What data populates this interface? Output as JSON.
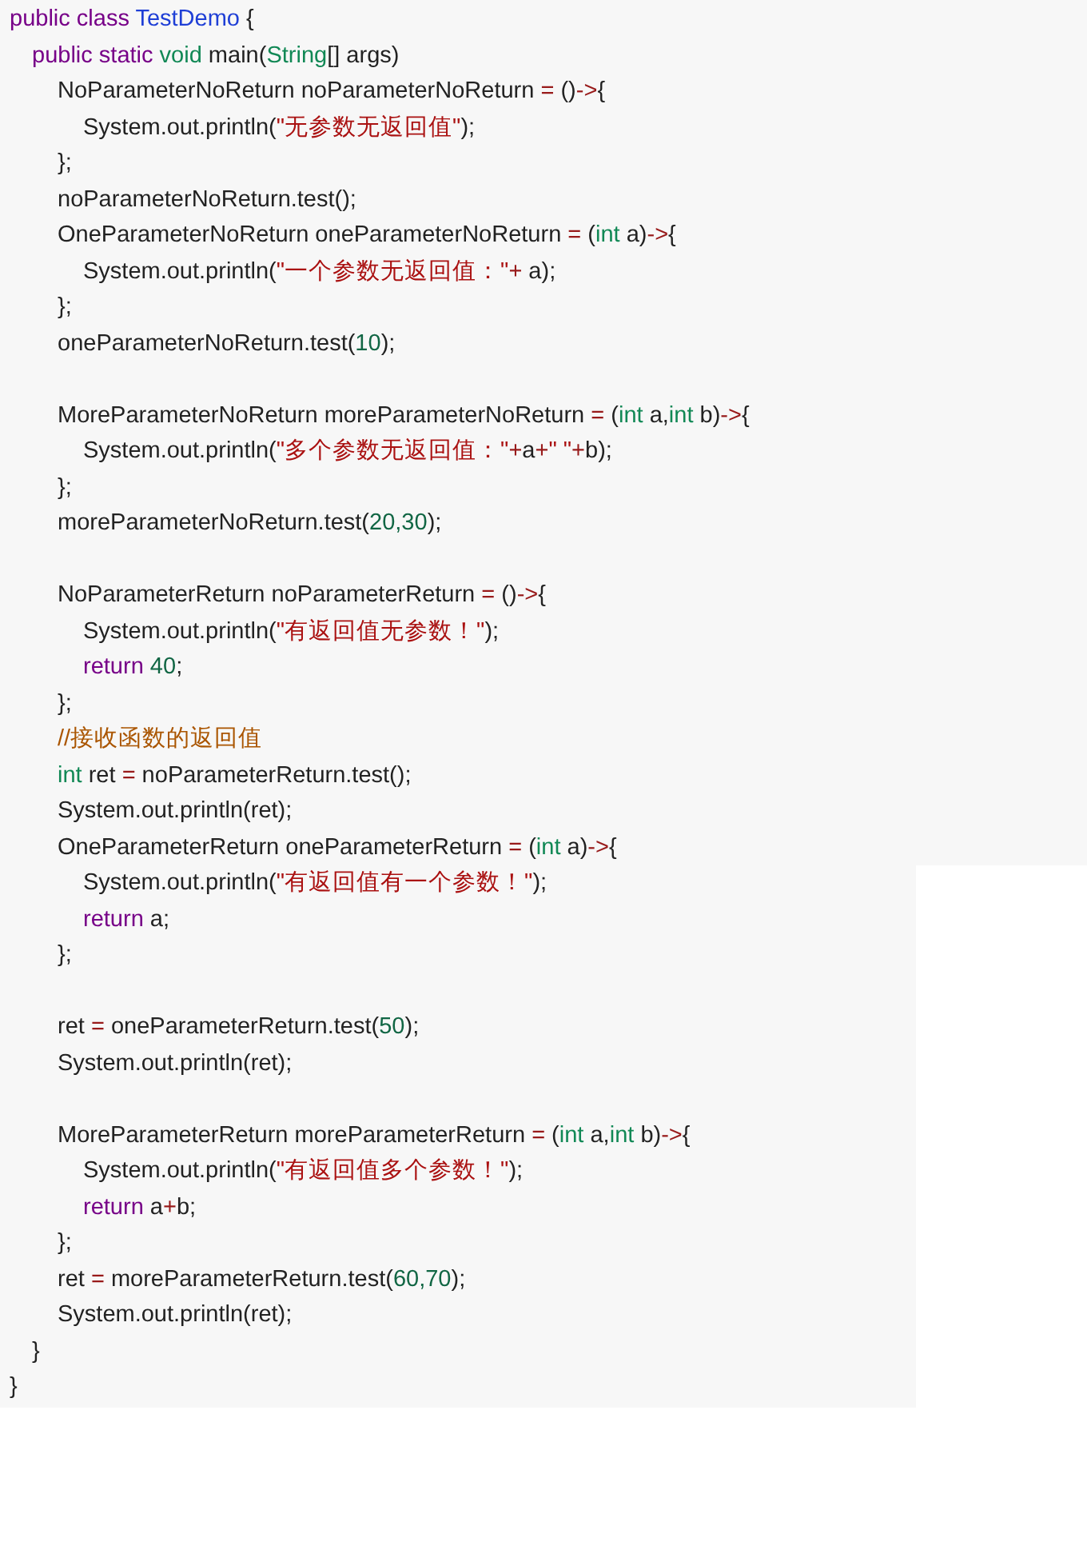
{
  "code_lines": [
    {
      "tokens": [
        {
          "kind": "keyword",
          "text": "public class "
        },
        {
          "kind": "def",
          "text": "TestDemo"
        },
        {
          "kind": "plain",
          "text": " {"
        }
      ],
      "children": [
        {
          "tokens": [
            {
              "kind": "keyword",
              "text": "public static "
            },
            {
              "kind": "type",
              "text": "void"
            },
            {
              "kind": "plain",
              "text": " main("
            },
            {
              "kind": "type",
              "text": "String"
            },
            {
              "kind": "plain",
              "text": "[] args)"
            }
          ],
          "children": [
            {
              "tokens": [
                {
                  "kind": "plain",
                  "text": "NoParameterNoReturn noParameterNoReturn "
                },
                {
                  "kind": "operator",
                  "text": "="
                },
                {
                  "kind": "plain",
                  "text": " ()"
                },
                {
                  "kind": "operator",
                  "text": "->"
                },
                {
                  "kind": "plain",
                  "text": "{"
                }
              ],
              "children": [
                {
                  "tokens": [
                    {
                      "kind": "plain",
                      "text": "System.out.println("
                    },
                    {
                      "kind": "string",
                      "text": "\"无参数无返回值\""
                    },
                    {
                      "kind": "plain",
                      "text": ");"
                    }
                  ]
                }
              ]
            },
            {
              "tokens": [
                {
                  "kind": "plain",
                  "text": "};"
                }
              ]
            },
            {
              "tokens": [
                {
                  "kind": "plain",
                  "text": "noParameterNoReturn.test();"
                }
              ]
            },
            {
              "tokens": [
                {
                  "kind": "plain",
                  "text": "OneParameterNoReturn oneParameterNoReturn "
                },
                {
                  "kind": "operator",
                  "text": "="
                },
                {
                  "kind": "plain",
                  "text": " ("
                },
                {
                  "kind": "type",
                  "text": "int"
                },
                {
                  "kind": "plain",
                  "text": " a)"
                },
                {
                  "kind": "operator",
                  "text": "->"
                },
                {
                  "kind": "plain",
                  "text": "{"
                }
              ],
              "children": [
                {
                  "tokens": [
                    {
                      "kind": "plain",
                      "text": "System.out.println("
                    },
                    {
                      "kind": "string",
                      "text": "\"一个参数无返回值：\""
                    },
                    {
                      "kind": "operator",
                      "text": "+"
                    },
                    {
                      "kind": "plain",
                      "text": " a);"
                    }
                  ]
                }
              ]
            },
            {
              "tokens": [
                {
                  "kind": "plain",
                  "text": "};"
                }
              ]
            },
            {
              "tokens": [
                {
                  "kind": "plain",
                  "text": "oneParameterNoReturn.test("
                },
                {
                  "kind": "number",
                  "text": "10"
                },
                {
                  "kind": "plain",
                  "text": ");"
                }
              ]
            },
            {
              "kind": "blank"
            },
            {
              "tokens": [
                {
                  "kind": "plain",
                  "text": "MoreParameterNoReturn moreParameterNoReturn "
                },
                {
                  "kind": "operator",
                  "text": "="
                },
                {
                  "kind": "plain",
                  "text": " ("
                },
                {
                  "kind": "type",
                  "text": "int"
                },
                {
                  "kind": "plain",
                  "text": " a,"
                },
                {
                  "kind": "type",
                  "text": "int"
                },
                {
                  "kind": "plain",
                  "text": " b)"
                },
                {
                  "kind": "operator",
                  "text": "->"
                },
                {
                  "kind": "plain",
                  "text": "{"
                }
              ],
              "children": [
                {
                  "tokens": [
                    {
                      "kind": "plain",
                      "text": "System.out.println("
                    },
                    {
                      "kind": "string",
                      "text": "\"多个参数无返回值：\""
                    },
                    {
                      "kind": "operator",
                      "text": "+"
                    },
                    {
                      "kind": "plain",
                      "text": "a"
                    },
                    {
                      "kind": "operator",
                      "text": "+"
                    },
                    {
                      "kind": "string",
                      "text": "\" \""
                    },
                    {
                      "kind": "operator",
                      "text": "+"
                    },
                    {
                      "kind": "plain",
                      "text": "b);"
                    }
                  ]
                }
              ]
            },
            {
              "tokens": [
                {
                  "kind": "plain",
                  "text": "};"
                }
              ]
            },
            {
              "tokens": [
                {
                  "kind": "plain",
                  "text": "moreParameterNoReturn.test("
                },
                {
                  "kind": "number",
                  "text": "20,30"
                },
                {
                  "kind": "plain",
                  "text": ");"
                }
              ]
            },
            {
              "kind": "blank"
            },
            {
              "tokens": [
                {
                  "kind": "plain",
                  "text": "NoParameterReturn noParameterReturn "
                },
                {
                  "kind": "operator",
                  "text": "="
                },
                {
                  "kind": "plain",
                  "text": " ()"
                },
                {
                  "kind": "operator",
                  "text": "->"
                },
                {
                  "kind": "plain",
                  "text": "{"
                }
              ],
              "children": [
                {
                  "tokens": [
                    {
                      "kind": "plain",
                      "text": "System.out.println("
                    },
                    {
                      "kind": "string",
                      "text": "\"有返回值无参数！\""
                    },
                    {
                      "kind": "plain",
                      "text": ");"
                    }
                  ]
                },
                {
                  "tokens": [
                    {
                      "kind": "keyword",
                      "text": "return "
                    },
                    {
                      "kind": "number",
                      "text": "40"
                    },
                    {
                      "kind": "plain",
                      "text": ";"
                    }
                  ]
                }
              ]
            },
            {
              "tokens": [
                {
                  "kind": "plain",
                  "text": "};"
                }
              ]
            },
            {
              "tokens": [
                {
                  "kind": "comment",
                  "text": "//接收函数的返回值"
                }
              ]
            },
            {
              "tokens": [
                {
                  "kind": "type",
                  "text": "int"
                },
                {
                  "kind": "plain",
                  "text": " ret "
                },
                {
                  "kind": "operator",
                  "text": "="
                },
                {
                  "kind": "plain",
                  "text": " noParameterReturn.test();"
                }
              ]
            },
            {
              "tokens": [
                {
                  "kind": "plain",
                  "text": "System.out.println(ret);"
                }
              ]
            },
            {
              "tokens": [
                {
                  "kind": "plain",
                  "text": "OneParameterReturn oneParameterReturn "
                },
                {
                  "kind": "operator",
                  "text": "="
                },
                {
                  "kind": "plain",
                  "text": " ("
                },
                {
                  "kind": "type",
                  "text": "int"
                },
                {
                  "kind": "plain",
                  "text": " a)"
                },
                {
                  "kind": "operator",
                  "text": "->"
                },
                {
                  "kind": "plain",
                  "text": "{"
                }
              ],
              "children": [
                {
                  "kind": "panel_break"
                },
                {
                  "tokens": [
                    {
                      "kind": "plain",
                      "text": "System.out.println("
                    },
                    {
                      "kind": "string",
                      "text": "\"有返回值有一个参数！\""
                    },
                    {
                      "kind": "plain",
                      "text": ");"
                    }
                  ]
                },
                {
                  "tokens": [
                    {
                      "kind": "keyword",
                      "text": "return"
                    },
                    {
                      "kind": "plain",
                      "text": " a;"
                    }
                  ]
                }
              ]
            },
            {
              "tokens": [
                {
                  "kind": "plain",
                  "text": "};"
                }
              ]
            },
            {
              "kind": "blank"
            },
            {
              "tokens": [
                {
                  "kind": "plain",
                  "text": "ret "
                },
                {
                  "kind": "operator",
                  "text": "="
                },
                {
                  "kind": "plain",
                  "text": " oneParameterReturn.test("
                },
                {
                  "kind": "number",
                  "text": "50"
                },
                {
                  "kind": "plain",
                  "text": ");"
                }
              ]
            },
            {
              "tokens": [
                {
                  "kind": "plain",
                  "text": "System.out.println(ret);"
                }
              ]
            },
            {
              "kind": "blank"
            },
            {
              "tokens": [
                {
                  "kind": "plain",
                  "text": "MoreParameterReturn moreParameterReturn "
                },
                {
                  "kind": "operator",
                  "text": "="
                },
                {
                  "kind": "plain",
                  "text": " ("
                },
                {
                  "kind": "type",
                  "text": "int"
                },
                {
                  "kind": "plain",
                  "text": " a,"
                },
                {
                  "kind": "type",
                  "text": "int"
                },
                {
                  "kind": "plain",
                  "text": " b)"
                },
                {
                  "kind": "operator",
                  "text": "->"
                },
                {
                  "kind": "plain",
                  "text": "{"
                }
              ],
              "children": [
                {
                  "tokens": [
                    {
                      "kind": "plain",
                      "text": "System.out.println("
                    },
                    {
                      "kind": "string",
                      "text": "\"有返回值多个参数！\""
                    },
                    {
                      "kind": "plain",
                      "text": ");"
                    }
                  ]
                },
                {
                  "tokens": [
                    {
                      "kind": "keyword",
                      "text": "return"
                    },
                    {
                      "kind": "plain",
                      "text": " a"
                    },
                    {
                      "kind": "operator",
                      "text": "+"
                    },
                    {
                      "kind": "plain",
                      "text": "b;"
                    }
                  ]
                }
              ]
            },
            {
              "tokens": [
                {
                  "kind": "plain",
                  "text": "};"
                }
              ]
            },
            {
              "tokens": [
                {
                  "kind": "plain",
                  "text": "ret "
                },
                {
                  "kind": "operator",
                  "text": "="
                },
                {
                  "kind": "plain",
                  "text": " moreParameterReturn.test("
                },
                {
                  "kind": "number",
                  "text": "60,70"
                },
                {
                  "kind": "plain",
                  "text": ");"
                }
              ]
            },
            {
              "tokens": [
                {
                  "kind": "plain",
                  "text": "System.out.println(ret);"
                }
              ]
            }
          ]
        },
        {
          "tokens": [
            {
              "kind": "plain",
              "text": "}"
            }
          ]
        }
      ]
    },
    {
      "tokens": [
        {
          "kind": "plain",
          "text": "}"
        }
      ]
    }
  ]
}
